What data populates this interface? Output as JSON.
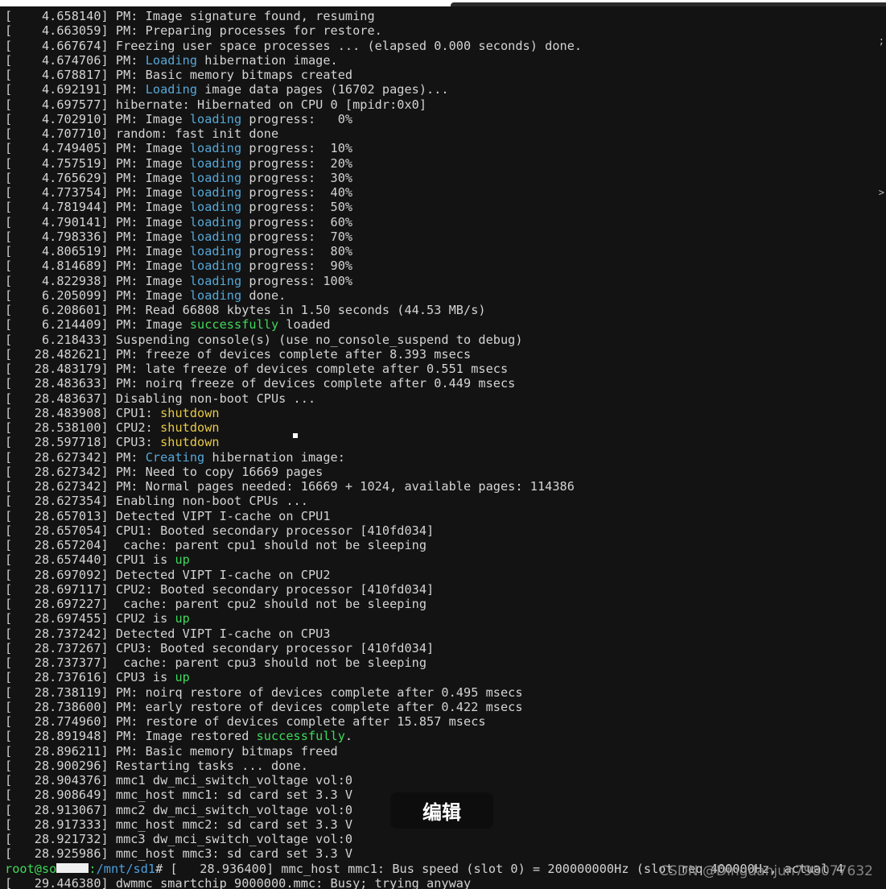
{
  "colors": {
    "background": "#131313",
    "text": "#d4d4d4",
    "highlight_blue": "#55a8d8",
    "highlight_green": "#3fd95a",
    "highlight_yellow": "#e6c84a"
  },
  "terminal": {
    "lines": [
      [
        {
          "t": "[    4.658140] PM: Image signature found, resuming"
        }
      ],
      [
        {
          "t": "[    4.663059] PM: Preparing processes for restore."
        }
      ],
      [
        {
          "t": "[    4.667674] Freezing user space processes ... (elapsed 0.000 seconds) done."
        }
      ],
      [
        {
          "t": "[    4.674706] PM: "
        },
        {
          "t": "Loading",
          "c": "blue"
        },
        {
          "t": " hibernation image."
        }
      ],
      [
        {
          "t": "[    4.678817] PM: Basic memory bitmaps created"
        }
      ],
      [
        {
          "t": "[    4.692191] PM: "
        },
        {
          "t": "Loading",
          "c": "blue"
        },
        {
          "t": " image data pages (16702 pages)..."
        }
      ],
      [
        {
          "t": "[    4.697577] hibernate: Hibernated on CPU 0 [mpidr:0x0]"
        }
      ],
      [
        {
          "t": "[    4.702910] PM: Image "
        },
        {
          "t": "loading",
          "c": "blue"
        },
        {
          "t": " progress:   0%"
        }
      ],
      [
        {
          "t": "[    4.707710] random: fast init done"
        }
      ],
      [
        {
          "t": "[    4.749405] PM: Image "
        },
        {
          "t": "loading",
          "c": "blue"
        },
        {
          "t": " progress:  10%"
        }
      ],
      [
        {
          "t": "[    4.757519] PM: Image "
        },
        {
          "t": "loading",
          "c": "blue"
        },
        {
          "t": " progress:  20%"
        }
      ],
      [
        {
          "t": "[    4.765629] PM: Image "
        },
        {
          "t": "loading",
          "c": "blue"
        },
        {
          "t": " progress:  30%"
        }
      ],
      [
        {
          "t": "[    4.773754] PM: Image "
        },
        {
          "t": "loading",
          "c": "blue"
        },
        {
          "t": " progress:  40%"
        }
      ],
      [
        {
          "t": "[    4.781944] PM: Image "
        },
        {
          "t": "loading",
          "c": "blue"
        },
        {
          "t": " progress:  50%"
        }
      ],
      [
        {
          "t": "[    4.790141] PM: Image "
        },
        {
          "t": "loading",
          "c": "blue"
        },
        {
          "t": " progress:  60%"
        }
      ],
      [
        {
          "t": "[    4.798336] PM: Image "
        },
        {
          "t": "loading",
          "c": "blue"
        },
        {
          "t": " progress:  70%"
        }
      ],
      [
        {
          "t": "[    4.806519] PM: Image "
        },
        {
          "t": "loading",
          "c": "blue"
        },
        {
          "t": " progress:  80%"
        }
      ],
      [
        {
          "t": "[    4.814689] PM: Image "
        },
        {
          "t": "loading",
          "c": "blue"
        },
        {
          "t": " progress:  90%"
        }
      ],
      [
        {
          "t": "[    4.822938] PM: Image "
        },
        {
          "t": "loading",
          "c": "blue"
        },
        {
          "t": " progress: 100%"
        }
      ],
      [
        {
          "t": "[    6.205099] PM: Image "
        },
        {
          "t": "loading",
          "c": "blue"
        },
        {
          "t": " done."
        }
      ],
      [
        {
          "t": "[    6.208601] PM: Read 66808 kbytes in 1.50 seconds (44.53 MB/s)"
        }
      ],
      [
        {
          "t": "[    6.214409] PM: Image "
        },
        {
          "t": "successfully",
          "c": "green"
        },
        {
          "t": " loaded"
        }
      ],
      [
        {
          "t": "[    6.218433] Suspending console(s) (use no_console_suspend to debug)"
        }
      ],
      [
        {
          "t": "[   28.482621] PM: freeze of devices complete after 8.393 msecs"
        }
      ],
      [
        {
          "t": "[   28.483179] PM: late freeze of devices complete after 0.551 msecs"
        }
      ],
      [
        {
          "t": "[   28.483633] PM: noirq freeze of devices complete after 0.449 msecs"
        }
      ],
      [
        {
          "t": "[   28.483637] Disabling non-boot CPUs ..."
        }
      ],
      [
        {
          "t": "[   28.483908] CPU1: "
        },
        {
          "t": "shutdown",
          "c": "yellow"
        }
      ],
      [
        {
          "t": "[   28.538100] CPU2: "
        },
        {
          "t": "shutdown",
          "c": "yellow"
        }
      ],
      [
        {
          "t": "[   28.597718] CPU3: "
        },
        {
          "t": "shutdown",
          "c": "yellow"
        }
      ],
      [
        {
          "t": "[   28.627342] PM: "
        },
        {
          "t": "Creating",
          "c": "blue"
        },
        {
          "t": " hibernation image:"
        }
      ],
      [
        {
          "t": "[   28.627342] PM: Need to copy 16669 pages"
        }
      ],
      [
        {
          "t": "[   28.627342] PM: Normal pages needed: 16669 + 1024, available pages: 114386"
        }
      ],
      [
        {
          "t": "[   28.627354] Enabling non-boot CPUs ..."
        }
      ],
      [
        {
          "t": "[   28.657013] Detected VIPT I-cache on CPU1"
        }
      ],
      [
        {
          "t": "[   28.657054] CPU1: Booted secondary processor [410fd034]"
        }
      ],
      [
        {
          "t": "[   28.657204]  cache: parent cpu1 should not be sleeping"
        }
      ],
      [
        {
          "t": "[   28.657440] CPU1 is "
        },
        {
          "t": "up",
          "c": "green"
        }
      ],
      [
        {
          "t": "[   28.697092] Detected VIPT I-cache on CPU2"
        }
      ],
      [
        {
          "t": "[   28.697117] CPU2: Booted secondary processor [410fd034]"
        }
      ],
      [
        {
          "t": "[   28.697227]  cache: parent cpu2 should not be sleeping"
        }
      ],
      [
        {
          "t": "[   28.697455] CPU2 is "
        },
        {
          "t": "up",
          "c": "green"
        }
      ],
      [
        {
          "t": "[   28.737242] Detected VIPT I-cache on CPU3"
        }
      ],
      [
        {
          "t": "[   28.737267] CPU3: Booted secondary processor [410fd034]"
        }
      ],
      [
        {
          "t": "[   28.737377]  cache: parent cpu3 should not be sleeping"
        }
      ],
      [
        {
          "t": "[   28.737616] CPU3 is "
        },
        {
          "t": "up",
          "c": "green"
        }
      ],
      [
        {
          "t": "[   28.738119] PM: noirq restore of devices complete after 0.495 msecs"
        }
      ],
      [
        {
          "t": "[   28.738600] PM: early restore of devices complete after 0.422 msecs"
        }
      ],
      [
        {
          "t": "[   28.774960] PM: restore of devices complete after 15.857 msecs"
        }
      ],
      [
        {
          "t": "[   28.891948] PM: Image restored "
        },
        {
          "t": "successfully",
          "c": "green"
        },
        {
          "t": "."
        }
      ],
      [
        {
          "t": "[   28.896211] PM: Basic memory bitmaps freed"
        }
      ],
      [
        {
          "t": "[   28.900296] Restarting tasks ... done."
        }
      ],
      [
        {
          "t": "[   28.904376] mmc1 dw_mci_switch_voltage vol:0"
        }
      ],
      [
        {
          "t": "[   28.908649] mmc_host mmc1: sd card set 3.3 V"
        }
      ],
      [
        {
          "t": "[   28.913067] mmc2 dw_mci_switch_voltage vol:0"
        }
      ],
      [
        {
          "t": "[   28.917333] mmc_host mmc2: sd card set 3.3 V"
        }
      ],
      [
        {
          "t": "[   28.921732] mmc3 dw_mci_switch_voltage vol:0"
        }
      ],
      [
        {
          "t": "[   28.925986] mmc_host mmc3: sd card set 3.3 V"
        }
      ],
      [
        {
          "t": "root@so",
          "c": "prompt"
        },
        {
          "redact": true
        },
        {
          "t": ":",
          "c": "prompt"
        },
        {
          "t": "/mnt/sd1",
          "c": "path"
        },
        {
          "t": "# [   28.936400] mmc_host mmc1: Bus speed (slot 0) = 200000000Hz (slot req 400000Hz, actual 4"
        }
      ],
      [
        {
          "t": "[   29.446380] dwmmc_smartchip 9000000.mmc: Busy; trying anyway"
        }
      ]
    ]
  },
  "overlay": {
    "edit_label": "编辑",
    "watermark": "CSDN @Dingdanjun798077632"
  },
  "edge_marks": [
    ";",
    ">"
  ]
}
